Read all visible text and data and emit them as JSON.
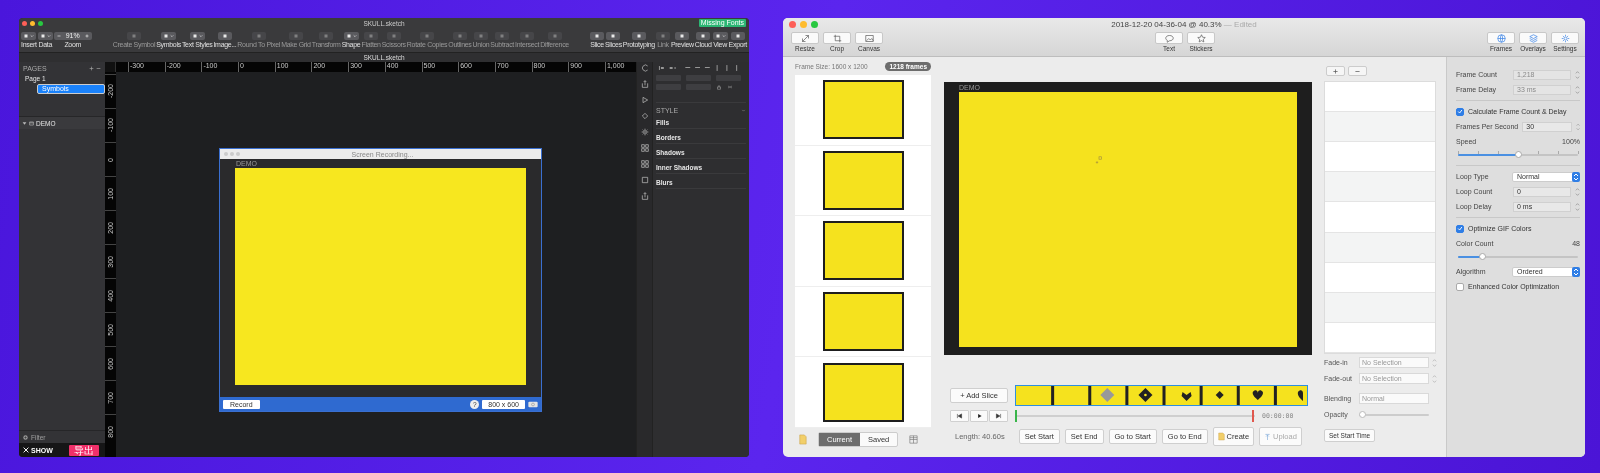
{
  "sketch": {
    "title": "SKULL.sketch",
    "badge": "Missing Fonts",
    "toolbar": {
      "left": [
        {
          "label": "Insert",
          "kind": "menu",
          "disabled": false
        },
        {
          "label": "Data",
          "kind": "menu",
          "disabled": false
        },
        {
          "label": "Zoom",
          "kind": "zoom",
          "value": "91%",
          "disabled": false
        }
      ],
      "center": [
        {
          "label": "Create Symbol",
          "kind": "plain",
          "disabled": true
        },
        {
          "label": "Symbols",
          "kind": "menu",
          "disabled": false
        },
        {
          "label": "Text Styles",
          "kind": "menu",
          "disabled": false
        },
        {
          "label": "Image...",
          "kind": "plain",
          "disabled": false
        },
        {
          "label": "Round To Pixel",
          "kind": "plain",
          "disabled": true
        },
        {
          "label": "Make Grid",
          "kind": "plain",
          "disabled": true
        },
        {
          "label": "Transform",
          "kind": "plain",
          "disabled": true
        },
        {
          "label": "Shape",
          "kind": "menu",
          "disabled": false
        },
        {
          "label": "Flatten",
          "kind": "plain",
          "disabled": true
        },
        {
          "label": "Scissors",
          "kind": "plain",
          "disabled": true
        },
        {
          "label": "Rotate Copies",
          "kind": "plain",
          "disabled": true
        },
        {
          "label": "Outlines",
          "kind": "plain",
          "disabled": true
        },
        {
          "label": "Union",
          "kind": "plain",
          "disabled": true
        },
        {
          "label": "Subtract",
          "kind": "plain",
          "disabled": true
        },
        {
          "label": "Intersect",
          "kind": "plain",
          "disabled": true
        },
        {
          "label": "Difference",
          "kind": "plain",
          "disabled": true
        }
      ],
      "right": [
        {
          "label": "Slice",
          "kind": "plain",
          "disabled": false
        },
        {
          "label": "Slices",
          "kind": "plain",
          "disabled": false
        },
        {
          "label": "Prototyping",
          "kind": "plain",
          "disabled": false
        },
        {
          "label": "Link",
          "kind": "plain",
          "disabled": true
        },
        {
          "label": "Preview",
          "kind": "plain",
          "disabled": false
        },
        {
          "label": "Cloud",
          "kind": "plain",
          "disabled": false
        },
        {
          "label": "View",
          "kind": "menu",
          "disabled": false
        },
        {
          "label": "Export",
          "kind": "plain",
          "disabled": false
        }
      ]
    },
    "doc_tab": "SKULL.sketch",
    "pages_heading": "PAGES",
    "pages": [
      {
        "label": "Page 1",
        "selected": false
      },
      {
        "label": "Symbols",
        "selected": true
      }
    ],
    "layer": "DEMO",
    "filter_placeholder": "Filter",
    "brand": "SHOW",
    "export_button": "导出",
    "h_ruler": [
      "-300",
      "-200",
      "-100",
      "0",
      "100",
      "200",
      "300",
      "400",
      "500",
      "600",
      "700",
      "800",
      "900",
      "1,000"
    ],
    "v_ruler": [
      "-200",
      "-100",
      "0",
      "100",
      "200",
      "300",
      "400",
      "500",
      "600",
      "700",
      "800"
    ],
    "recorder": {
      "title": "Screen Recording...",
      "label": "DEMO",
      "record_button": "Record",
      "help": "?",
      "size": "800 x 600"
    },
    "inspector": {
      "style_heading": "STYLE",
      "sections": [
        "Fills",
        "Borders",
        "Shadows",
        "Inner Shadows",
        "Blurs"
      ]
    }
  },
  "gif": {
    "title": "2018-12-20 04-36-04 @ 40.3%",
    "edited": " — Edited",
    "toolbar": {
      "left": [
        "Resize",
        "Crop",
        "Canvas"
      ],
      "center": [
        "Text",
        "Stickers"
      ],
      "right": [
        "Frames",
        "Overlays",
        "Settings"
      ]
    },
    "frame_size": "Frame Size: 1600 x 1200",
    "frame_count_badge": "1218 frames",
    "preview_label": "DEMO",
    "add_slice": "+ Add Slice",
    "timecode": "00:00:00",
    "length": "Length: 40.60s",
    "views": [
      {
        "label": "Current",
        "selected": true
      },
      {
        "label": "Saved",
        "selected": false
      }
    ],
    "actions": [
      {
        "label": "Set Start",
        "kind": "plain",
        "disabled": false
      },
      {
        "label": "Set End",
        "kind": "plain",
        "disabled": false
      },
      {
        "label": "Go to Start",
        "kind": "plain",
        "disabled": false
      },
      {
        "label": "Go to End",
        "kind": "plain",
        "disabled": false
      },
      {
        "label": "Create",
        "kind": "create",
        "disabled": false
      },
      {
        "label": "Upload",
        "kind": "upload",
        "disabled": true
      }
    ],
    "fades": [
      {
        "label": "Fade-in",
        "placeholder": "No Selection"
      },
      {
        "label": "Fade-out",
        "placeholder": "No Selection"
      }
    ],
    "blending": {
      "label": "Blending",
      "value": "Normal"
    },
    "opacity": {
      "label": "Opacity",
      "level": 0.0
    },
    "set_start_time": "Set Start Time",
    "settings": [
      {
        "kind": "stepper",
        "label": "Frame Count",
        "value": "1,218",
        "disabled": true
      },
      {
        "kind": "stepper",
        "label": "Frame Delay",
        "value": "33 ms",
        "disabled": true
      },
      {
        "kind": "divider"
      },
      {
        "kind": "checkbox",
        "label": "Calculate Frame Count & Delay",
        "checked": true
      },
      {
        "kind": "stepper",
        "label": "Frames Per Second",
        "value": "30",
        "disabled": false
      },
      {
        "kind": "slider",
        "label": "Speed",
        "reading": "100%",
        "level": 0.5,
        "ticks": true
      },
      {
        "kind": "divider"
      },
      {
        "kind": "select",
        "label": "Loop Type",
        "value": "Normal"
      },
      {
        "kind": "stepper",
        "label": "Loop Count",
        "value": "0",
        "disabled": false
      },
      {
        "kind": "stepper",
        "label": "Loop Delay",
        "value": "0 ms",
        "disabled": false
      },
      {
        "kind": "divider"
      },
      {
        "kind": "checkbox",
        "label": "Optimize GIF Colors",
        "checked": true
      },
      {
        "kind": "slider",
        "label": "Color Count",
        "reading": "48",
        "level": 0.2,
        "ticks": false
      },
      {
        "kind": "select",
        "label": "Algorithm",
        "value": "Ordered"
      },
      {
        "kind": "checkbox",
        "label": "Enhanced Color Optimization",
        "checked": false
      }
    ]
  }
}
